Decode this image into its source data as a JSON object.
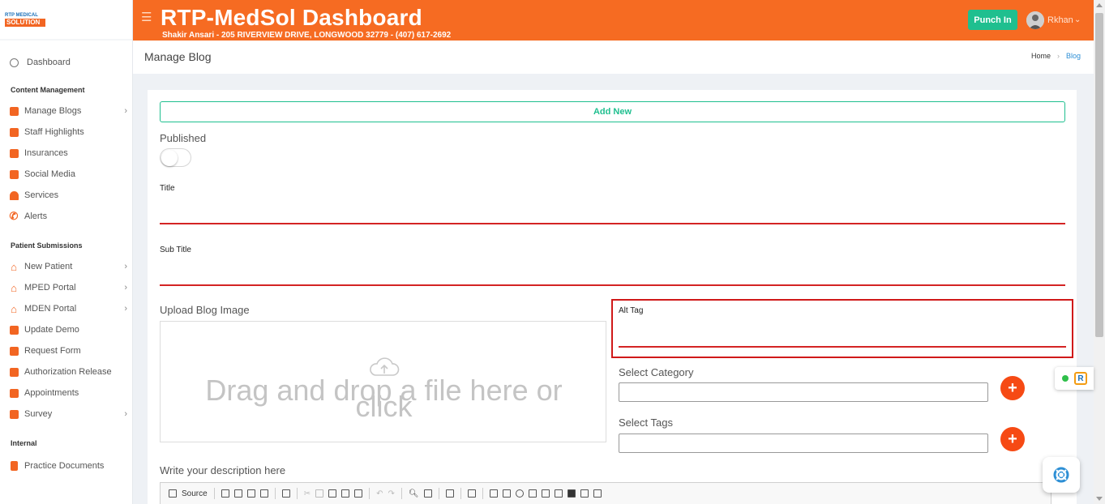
{
  "brand": {
    "logo_top": "RTP MEDICAL",
    "logo_bottom": "SOLUTION"
  },
  "header": {
    "title": "RTP-MedSol Dashboard",
    "subtitle": "Shakir Ansari - 205 RIVERVIEW DRIVE, LONGWOOD 32779 - (407) 617-2692",
    "punch_label": "Punch In",
    "user_name": "Rkhan"
  },
  "sidebar": {
    "dashboard": "Dashboard",
    "sections": {
      "content": "Content Management",
      "patient": "Patient Submissions",
      "internal": "Internal"
    },
    "content_items": [
      "Manage Blogs",
      "Staff Highlights",
      "Insurances",
      "Social Media",
      "Services",
      "Alerts"
    ],
    "patient_items": [
      "New Patient",
      "MPED Portal",
      "MDEN Portal",
      "Update Demo",
      "Request Form",
      "Authorization Release",
      "Appointments",
      "Survey"
    ],
    "internal_items": [
      "Practice Documents"
    ]
  },
  "page": {
    "title": "Manage Blog",
    "breadcrumb_home": "Home",
    "breadcrumb_current": "Blog"
  },
  "form": {
    "add_new": "Add New",
    "published_label": "Published",
    "published_on": false,
    "title_label": "Title",
    "subtitle_label": "Sub Title",
    "upload_label": "Upload Blog Image",
    "dropzone_line1": "Drag and drop a file here or",
    "dropzone_line2": "click",
    "alt_tag_label": "Alt Tag",
    "category_label": "Select Category",
    "tags_label": "Select Tags",
    "description_label": "Write your description here",
    "editor_source": "Source"
  },
  "colors": {
    "header": "#f66b22",
    "accent_green": "#1fbf8f",
    "error_red": "#d42424",
    "plus_orange": "#f64a14"
  }
}
